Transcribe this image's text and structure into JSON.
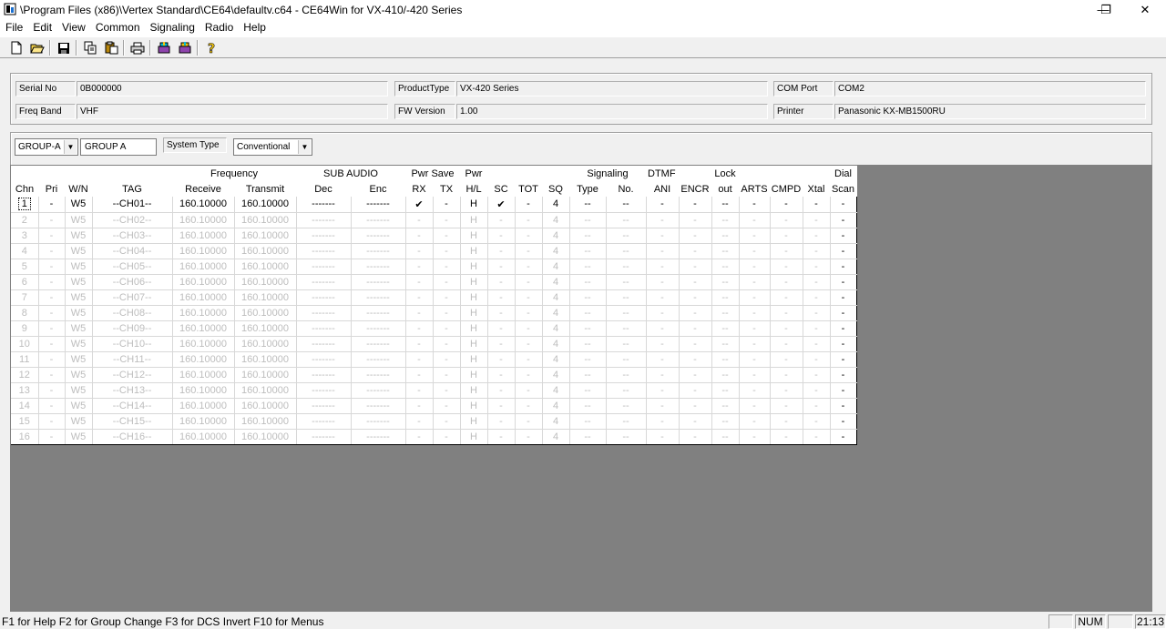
{
  "window": {
    "title": "\\Program Files (x86)\\Vertex Standard\\CE64\\defaultv.c64 - CE64Win for VX-410/-420 Series",
    "minimize": "—",
    "restore": "❐",
    "close": "✕"
  },
  "menu": [
    "File",
    "Edit",
    "View",
    "Common",
    "Signaling",
    "Radio",
    "Help"
  ],
  "toolbar": {
    "icons": [
      "new-icon",
      "open-icon",
      "save-icon",
      "copy-icon",
      "paste-icon",
      "print-icon",
      "read-radio-icon",
      "write-radio-icon",
      "help-icon"
    ]
  },
  "info": {
    "serial_label": "Serial No",
    "serial_value": "0B000000",
    "product_label": "ProductType",
    "product_value": "VX-420 Series",
    "com_label": "COM Port",
    "com_value": "COM2",
    "band_label": "Freq Band",
    "band_value": "VHF",
    "fw_label": "FW Version",
    "fw_value": "1.00",
    "printer_label": "Printer",
    "printer_value": "Panasonic KX-MB1500RU"
  },
  "group": {
    "group_select": "GROUP-A",
    "group_name": "GROUP A",
    "system_type_label": "System Type",
    "system_type_value": "Conventional"
  },
  "grid": {
    "header_top": [
      "",
      "",
      "",
      "",
      "Frequency",
      "",
      "SUB AUDIO",
      "",
      "Pwr Save",
      "",
      "Pwr",
      "",
      "",
      "",
      "Signaling",
      "",
      "DTMF",
      "",
      "Lock",
      "",
      "",
      "",
      "Dial"
    ],
    "header_bottom": [
      "Chn",
      "Pri",
      "W/N",
      "TAG",
      "Receive",
      "Transmit",
      "Dec",
      "Enc",
      "RX",
      "TX",
      "H/L",
      "SC",
      "TOT",
      "SQ",
      "Type",
      "No.",
      "ANI",
      "ENCR",
      "out",
      "ARTS",
      "CMPD",
      "Xtal",
      "Scan"
    ],
    "rows": [
      [
        "1",
        "-",
        "W5",
        "--CH01--",
        "160.10000",
        "160.10000",
        "-------",
        "-------",
        "✔",
        "-",
        "H",
        "✔",
        "-",
        "4",
        "--",
        "--",
        "-",
        "-",
        "--",
        "-",
        "-",
        "-",
        "-"
      ],
      [
        "2",
        "-",
        "W5",
        "--CH02--",
        "160.10000",
        "160.10000",
        "-------",
        "-------",
        "-",
        "-",
        "H",
        "-",
        "-",
        "4",
        "--",
        "--",
        "-",
        "-",
        "--",
        "-",
        "-",
        "-",
        "-"
      ],
      [
        "3",
        "-",
        "W5",
        "--CH03--",
        "160.10000",
        "160.10000",
        "-------",
        "-------",
        "-",
        "-",
        "H",
        "-",
        "-",
        "4",
        "--",
        "--",
        "-",
        "-",
        "--",
        "-",
        "-",
        "-",
        "-"
      ],
      [
        "4",
        "-",
        "W5",
        "--CH04--",
        "160.10000",
        "160.10000",
        "-------",
        "-------",
        "-",
        "-",
        "H",
        "-",
        "-",
        "4",
        "--",
        "--",
        "-",
        "-",
        "--",
        "-",
        "-",
        "-",
        "-"
      ],
      [
        "5",
        "-",
        "W5",
        "--CH05--",
        "160.10000",
        "160.10000",
        "-------",
        "-------",
        "-",
        "-",
        "H",
        "-",
        "-",
        "4",
        "--",
        "--",
        "-",
        "-",
        "--",
        "-",
        "-",
        "-",
        "-"
      ],
      [
        "6",
        "-",
        "W5",
        "--CH06--",
        "160.10000",
        "160.10000",
        "-------",
        "-------",
        "-",
        "-",
        "H",
        "-",
        "-",
        "4",
        "--",
        "--",
        "-",
        "-",
        "--",
        "-",
        "-",
        "-",
        "-"
      ],
      [
        "7",
        "-",
        "W5",
        "--CH07--",
        "160.10000",
        "160.10000",
        "-------",
        "-------",
        "-",
        "-",
        "H",
        "-",
        "-",
        "4",
        "--",
        "--",
        "-",
        "-",
        "--",
        "-",
        "-",
        "-",
        "-"
      ],
      [
        "8",
        "-",
        "W5",
        "--CH08--",
        "160.10000",
        "160.10000",
        "-------",
        "-------",
        "-",
        "-",
        "H",
        "-",
        "-",
        "4",
        "--",
        "--",
        "-",
        "-",
        "--",
        "-",
        "-",
        "-",
        "-"
      ],
      [
        "9",
        "-",
        "W5",
        "--CH09--",
        "160.10000",
        "160.10000",
        "-------",
        "-------",
        "-",
        "-",
        "H",
        "-",
        "-",
        "4",
        "--",
        "--",
        "-",
        "-",
        "--",
        "-",
        "-",
        "-",
        "-"
      ],
      [
        "10",
        "-",
        "W5",
        "--CH10--",
        "160.10000",
        "160.10000",
        "-------",
        "-------",
        "-",
        "-",
        "H",
        "-",
        "-",
        "4",
        "--",
        "--",
        "-",
        "-",
        "--",
        "-",
        "-",
        "-",
        "-"
      ],
      [
        "11",
        "-",
        "W5",
        "--CH11--",
        "160.10000",
        "160.10000",
        "-------",
        "-------",
        "-",
        "-",
        "H",
        "-",
        "-",
        "4",
        "--",
        "--",
        "-",
        "-",
        "--",
        "-",
        "-",
        "-",
        "-"
      ],
      [
        "12",
        "-",
        "W5",
        "--CH12--",
        "160.10000",
        "160.10000",
        "-------",
        "-------",
        "-",
        "-",
        "H",
        "-",
        "-",
        "4",
        "--",
        "--",
        "-",
        "-",
        "--",
        "-",
        "-",
        "-",
        "-"
      ],
      [
        "13",
        "-",
        "W5",
        "--CH13--",
        "160.10000",
        "160.10000",
        "-------",
        "-------",
        "-",
        "-",
        "H",
        "-",
        "-",
        "4",
        "--",
        "--",
        "-",
        "-",
        "--",
        "-",
        "-",
        "-",
        "-"
      ],
      [
        "14",
        "-",
        "W5",
        "--CH14--",
        "160.10000",
        "160.10000",
        "-------",
        "-------",
        "-",
        "-",
        "H",
        "-",
        "-",
        "4",
        "--",
        "--",
        "-",
        "-",
        "--",
        "-",
        "-",
        "-",
        "-"
      ],
      [
        "15",
        "-",
        "W5",
        "--CH15--",
        "160.10000",
        "160.10000",
        "-------",
        "-------",
        "-",
        "-",
        "H",
        "-",
        "-",
        "4",
        "--",
        "--",
        "-",
        "-",
        "--",
        "-",
        "-",
        "-",
        "-"
      ],
      [
        "16",
        "-",
        "W5",
        "--CH16--",
        "160.10000",
        "160.10000",
        "-------",
        "-------",
        "-",
        "-",
        "H",
        "-",
        "-",
        "4",
        "--",
        "--",
        "-",
        "-",
        "--",
        "-",
        "-",
        "-",
        "-"
      ]
    ]
  },
  "status": {
    "text": "F1 for Help   F2 for Group Change   F3 for DCS Invert   F10 for Menus",
    "num": "NUM",
    "time": "21:13"
  }
}
